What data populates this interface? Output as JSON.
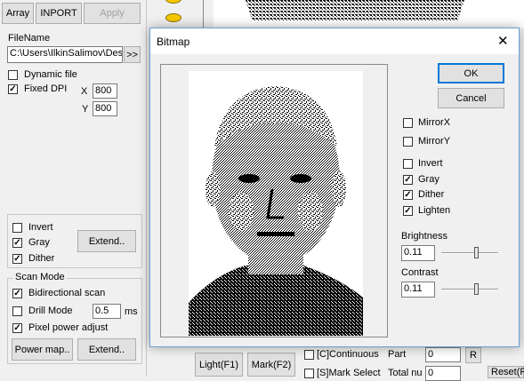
{
  "main": {
    "toolbar": {
      "array": "Array",
      "inport": "INPORT",
      "apply": "Apply"
    },
    "filename_label": "FileName",
    "filename_value": "C:\\Users\\IlkinSalimov\\Des",
    "browse": ">>",
    "dynamic_file": {
      "label": "Dynamic file",
      "checked": false
    },
    "fixed_dpi": {
      "label": "Fixed DPI",
      "checked": true
    },
    "x_label": "X",
    "x_value": "800",
    "y_label": "Y",
    "y_value": "800",
    "image_opts": {
      "invert": {
        "label": "Invert",
        "checked": false
      },
      "gray": {
        "label": "Gray",
        "checked": true
      },
      "dither": {
        "label": "Dither",
        "checked": true
      },
      "extend": "Extend.."
    },
    "scan_mode": {
      "title": "Scan Mode",
      "bidirectional": {
        "label": "Bidirectional scan",
        "checked": true
      },
      "drill": {
        "label": "Drill Mode",
        "checked": false
      },
      "drill_value": "0.5",
      "drill_unit": "ms",
      "pixel_power": {
        "label": "Pixel power adjust",
        "checked": true
      },
      "power_map": "Power map..",
      "extend": "Extend.."
    },
    "bottom": {
      "light": "Light(F1)",
      "mark": "Mark(F2)",
      "continuous": "[C]Continuous",
      "part": "Part",
      "part_value": "0",
      "r": "R",
      "mark_select": "[S]Mark Select",
      "total": "Total nu",
      "total_value": "0",
      "reset": "Reset(F"
    }
  },
  "dialog": {
    "title": "Bitmap",
    "close": "✕",
    "ok": "OK",
    "cancel": "Cancel",
    "mirror_x": {
      "label": "MirrorX",
      "checked": false
    },
    "mirror_y": {
      "label": "MirrorY",
      "checked": false
    },
    "invert": {
      "label": "Invert",
      "checked": false
    },
    "gray": {
      "label": "Gray",
      "checked": true
    },
    "dither": {
      "label": "Dither",
      "checked": true
    },
    "lighten": {
      "label": "Lighten",
      "checked": true
    },
    "brightness_label": "Brightness",
    "brightness_value": "0.11",
    "brightness_level": 0.65,
    "contrast_label": "Contrast",
    "contrast_value": "0.11",
    "contrast_level": 0.65
  },
  "check_mark": "✓"
}
